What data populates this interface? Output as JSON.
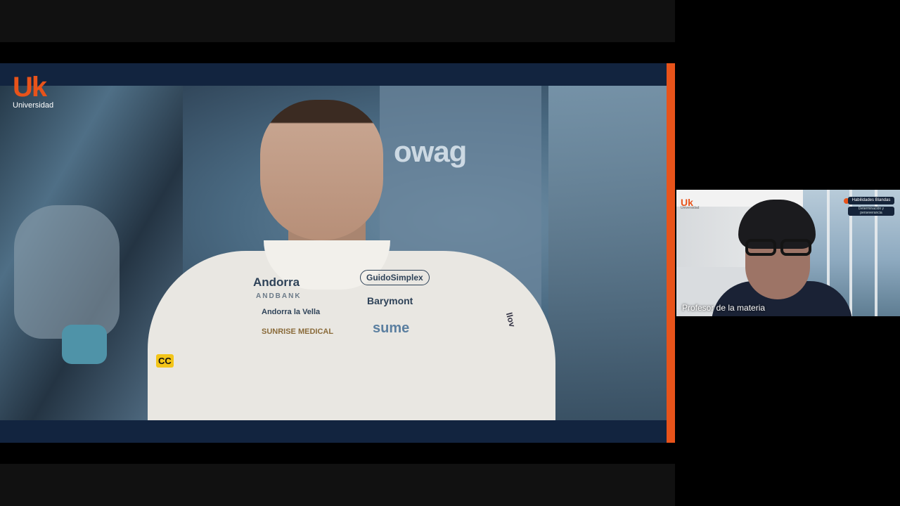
{
  "main_video": {
    "logo": {
      "mark": "Uk",
      "name": "Universidad"
    },
    "background_text": "owag",
    "sponsors": {
      "andorra": "Andorra",
      "andbank": "ANDBANK",
      "andorra_la_vella": "Andorra la Vella",
      "sunrise": "SUNRISE MEDICAL",
      "guidosimplex": "GuidoSimplex",
      "barymont": "Barymont",
      "sume": "sume",
      "left_patch": "CC",
      "right_patch": "llov"
    }
  },
  "participant_tile": {
    "label": "Profesor de la materia",
    "logo": {
      "mark": "Uk",
      "name": "Universidad"
    },
    "chip_title": "Habilidades Blandas",
    "chip_subtitle": "Determinación y perseverancia"
  },
  "colors": {
    "accent": "#e8531a",
    "stage_navy": "#12243f"
  }
}
